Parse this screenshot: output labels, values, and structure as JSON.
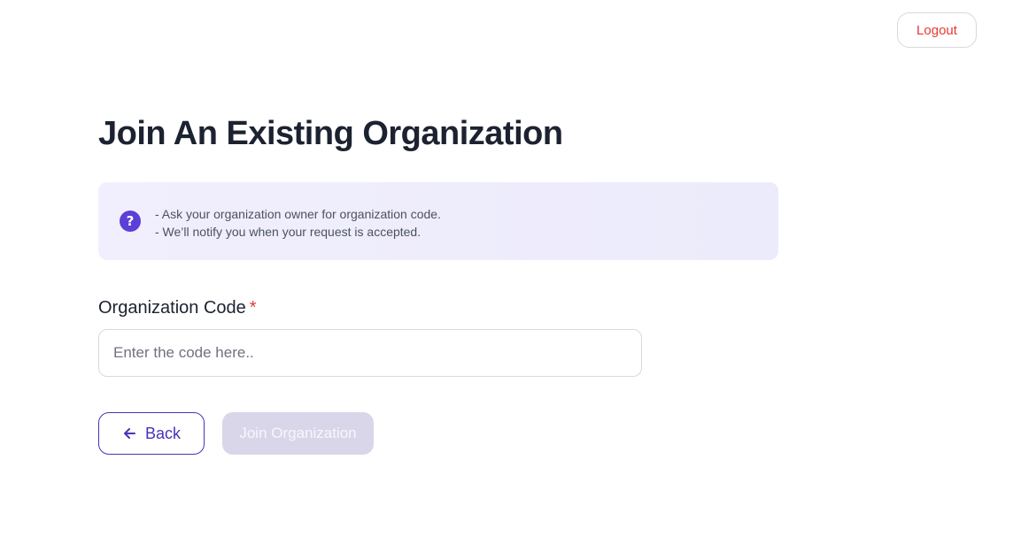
{
  "header": {
    "logout_label": "Logout"
  },
  "page": {
    "title": "Join An Existing Organization"
  },
  "info": {
    "icon": "question-icon",
    "icon_glyph": "?",
    "line1": "- Ask your organization owner for organization code.",
    "line2": "- We’ll notify you when your request is accepted."
  },
  "form": {
    "label": "Organization Code",
    "required_mark": "*",
    "placeholder": "Enter the code here..",
    "value": ""
  },
  "actions": {
    "back_label": "Back",
    "join_label": "Join Organization"
  },
  "colors": {
    "accent": "#4b32b8",
    "danger": "#e53935",
    "info_bg": "#f1effd",
    "disabled_bg": "#d9d6ea"
  }
}
